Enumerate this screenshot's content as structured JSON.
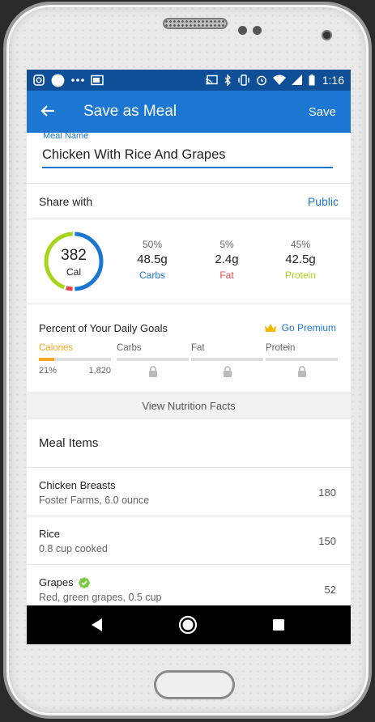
{
  "status_bar": {
    "time": "1:16",
    "left_icons": [
      "instagram-icon",
      "circle-icon",
      "more-icon",
      "cast-icon"
    ],
    "right_icons": [
      "cast-icon",
      "bluetooth-icon",
      "vibrate-icon",
      "alarm-icon",
      "wifi-icon",
      "signal-icon",
      "battery-icon"
    ]
  },
  "app_bar": {
    "title": "Save as Meal",
    "save_label": "Save"
  },
  "meal_name": {
    "label": "Meal Name",
    "value": "Chicken With Rice And Grapes"
  },
  "share": {
    "label": "Share with",
    "value": "Public"
  },
  "macros": {
    "calories": "382",
    "calories_label": "Cal",
    "items": [
      {
        "percent": "50%",
        "amount": "48.5g",
        "name": "Carbs",
        "color": "#1b77d2"
      },
      {
        "percent": "5%",
        "amount": "2.4g",
        "name": "Fat",
        "color": "#e8434f"
      },
      {
        "percent": "45%",
        "amount": "42.5g",
        "name": "Protein",
        "color": "#a7d51b"
      }
    ],
    "ring": {
      "carbs": 0.5,
      "fat": 0.05,
      "protein": 0.45
    }
  },
  "goals": {
    "title": "Percent of Your Daily Goals",
    "premium_label": "Go Premium",
    "columns": [
      {
        "name": "Calories",
        "percent": "21%",
        "goal": "1,820",
        "fill": 0.21,
        "active": true
      },
      {
        "name": "Carbs",
        "locked": true
      },
      {
        "name": "Fat",
        "locked": true
      },
      {
        "name": "Protein",
        "locked": true
      }
    ]
  },
  "view_facts_label": "View Nutrition Facts",
  "meal_items": {
    "title": "Meal Items",
    "items": [
      {
        "name": "Chicken Breasts",
        "desc": "Foster Farms, 6.0 ounce",
        "cal": "180",
        "verified": false
      },
      {
        "name": "Rice",
        "desc": "0.8 cup cooked",
        "cal": "150",
        "verified": false
      },
      {
        "name": "Grapes",
        "desc": "Red, green grapes, 0.5 cup",
        "cal": "52",
        "verified": true
      }
    ]
  },
  "colors": {
    "primary": "#1b77d2",
    "status_bar": "#0e4f97",
    "carbs": "#1b77d2",
    "fat": "#e8434f",
    "protein": "#a7d51b",
    "calories_goal": "#f5a623",
    "verified": "#7ac943"
  }
}
